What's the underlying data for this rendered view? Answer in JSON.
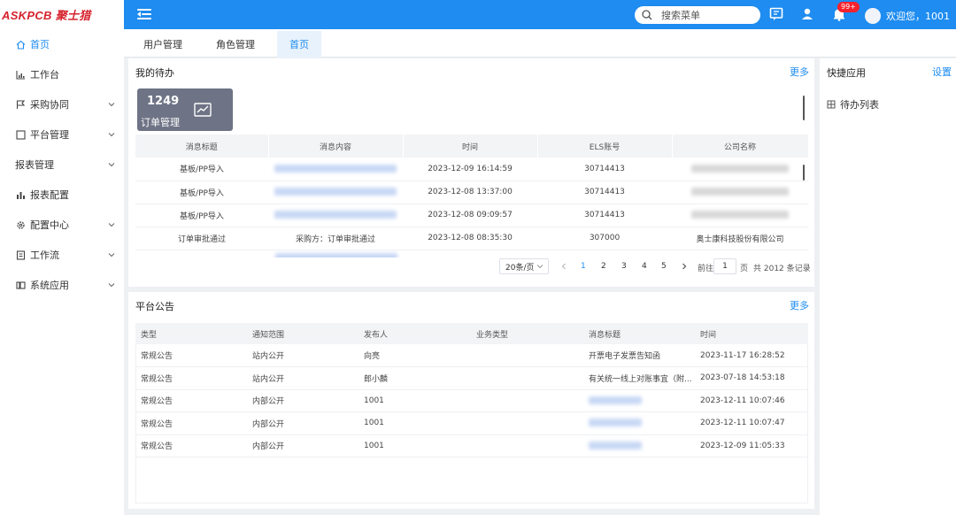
{
  "header": {
    "logo_text": "ASKPCB 聚士猎",
    "search_placeholder": "搜索菜单",
    "badge": "99+",
    "user_greeting": "欢迎您，1001",
    "brand_color": "#1e8cf0"
  },
  "sidebar": {
    "items": [
      {
        "label": "首页",
        "icon": "home-icon"
      },
      {
        "label": "工作台",
        "icon": "bar-chart-icon"
      },
      {
        "label": "采购协同",
        "icon": "flag-icon"
      },
      {
        "label": "平台管理",
        "icon": "square-icon"
      },
      {
        "label": "报表管理",
        "icon": ""
      },
      {
        "label": "报表配置",
        "icon": "column-chart-icon"
      },
      {
        "label": "配置中心",
        "icon": "gear-icon"
      },
      {
        "label": "工作流",
        "icon": "document-icon"
      },
      {
        "label": "系统应用",
        "icon": "app-icon"
      }
    ]
  },
  "tabs": [
    {
      "label": "用户管理"
    },
    {
      "label": "角色管理"
    },
    {
      "label": "首页"
    }
  ],
  "todo": {
    "title": "我的待办",
    "more": "更多",
    "card": {
      "count": "1249",
      "label": "订单管理"
    },
    "columns": [
      "消息标题",
      "消息内容",
      "时间",
      "ELS账号",
      "公司名称"
    ],
    "rows": [
      {
        "title": "基板/PP导入",
        "content": "",
        "time": "2023-12-09 16:14:59",
        "account": "30714413",
        "company": ""
      },
      {
        "title": "基板/PP导入",
        "content": "",
        "time": "2023-12-08 13:37:00",
        "account": "30714413",
        "company": ""
      },
      {
        "title": "基板/PP导入",
        "content": "",
        "time": "2023-12-08 09:09:57",
        "account": "30714413",
        "company": ""
      },
      {
        "title": "订单审批通过",
        "content": "采购方：订单审批通过",
        "time": "2023-12-08 08:35:30",
        "account": "307000",
        "company": "奥士康科技股份有限公司"
      }
    ],
    "pagination": {
      "page_size": "20条/页",
      "pages": [
        "1",
        "2",
        "3",
        "4",
        "5"
      ],
      "goto_label": "前往",
      "goto_value": "1",
      "page_unit": "页",
      "total": "共 2012 条记录"
    }
  },
  "notices": {
    "title": "平台公告",
    "more": "更多",
    "columns": [
      "类型",
      "通知范围",
      "发布人",
      "业务类型",
      "消息标题",
      "时间"
    ],
    "rows": [
      {
        "type": "常规公告",
        "scope": "站内公开",
        "publisher": "向亮",
        "biz": "",
        "subject": "开票电子发票告知函",
        "time": "2023-11-17 16:28:52"
      },
      {
        "type": "常规公告",
        "scope": "站内公开",
        "publisher": "郎小麟",
        "biz": "",
        "subject": "有关统一线上对账事宜（附...",
        "time": "2023-07-18 14:53:18"
      },
      {
        "type": "常规公告",
        "scope": "内部公开",
        "publisher": "1001",
        "biz": "",
        "subject": "",
        "time": "2023-12-11 10:07:46"
      },
      {
        "type": "常规公告",
        "scope": "内部公开",
        "publisher": "1001",
        "biz": "",
        "subject": "",
        "time": "2023-12-11 10:07:47"
      },
      {
        "type": "常规公告",
        "scope": "内部公开",
        "publisher": "1001",
        "biz": "",
        "subject": "",
        "time": "2023-12-09 11:05:33"
      }
    ]
  },
  "quick_apps": {
    "title": "快捷应用",
    "settings": "设置",
    "items": [
      {
        "label": "待办列表"
      }
    ]
  }
}
